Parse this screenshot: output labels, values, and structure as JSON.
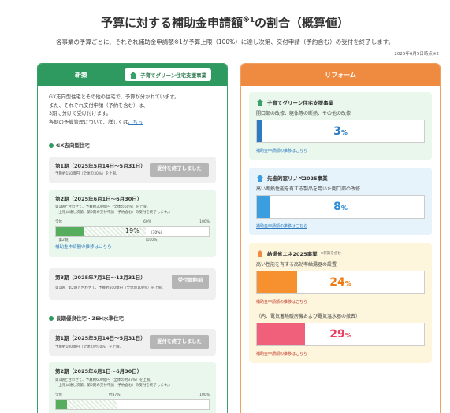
{
  "header": {
    "title": "予算に対する補助金申請額",
    "title_sup": "※1",
    "title_suffix": "の割合（概算値）",
    "subtitle": "各事業の予算ごとに、それぞれ補助金申請額※1が予算上限（100%）に達し次第、交付申請（予約含む）の受付を終了します。",
    "date": "2025年6月5日時点※2"
  },
  "colors": {
    "green": "#2e9a5f",
    "orange": "#ef8a41",
    "blue_bar": "#3a9ee0",
    "orange_bar": "#f7902e",
    "pink_bar": "#f0607a",
    "gray_bar": "#b5b5b5"
  },
  "left": {
    "header": "新築",
    "tag": "子育てグリーン住宅支援事業",
    "intro": [
      "GX志向型住宅とその他の住宅で、予算が分かれています。",
      "また、それぞれ交付申請（予約を含む）は、",
      "3期に分けて受け付けます。"
    ],
    "intro_last": "各期の予算管理について、詳しくは",
    "intro_link": "こちら",
    "gx": {
      "heading": "GX志向型住宅",
      "phase1": {
        "title": "第1期（2025年5月14日〜5月31日）",
        "desc": "予算約150億円（全体の30%）を上限。",
        "button": "受付を終了しました"
      },
      "phase2": {
        "title": "第2期（2025年6月1日〜6月30日）",
        "desc1": "第1期と合わせて、予算約300億円（全体の60%）を上限。",
        "desc2": "（上限に達し次第、第2期の交付申請（予約含む）の受付を終了します。）",
        "label_all": "全体",
        "label_60": "60%",
        "label_100": "100%",
        "percent": "19",
        "unit": "%",
        "marker": "（30%）",
        "under_left": "（第2期）",
        "under_right": "（100%）",
        "link": "補助金申請額の推移はこちら",
        "value": 0.19
      },
      "phase3": {
        "title": "第3期（2025年7月1日〜12月31日）",
        "desc": "第1期、第2期と合わせて、予算約500億円（全体の100%）を上限。",
        "button": "受付開始前"
      }
    },
    "long": {
      "heading": "長期優良住宅・ZEH水準住宅",
      "phase1": {
        "title": "第1期（2025年5月14日〜5月31日）",
        "desc": "予算約100億円（全体の約10%）を上限。",
        "button": "受付を終了しました"
      },
      "phase2": {
        "title": "第2期（2025年6月1日〜6月30日）",
        "desc1": "第1期と合わせて、予算約600億円（全体の約37%）を上限。",
        "desc2": "（上限に達し次第、第2期の交付申請（予約含む）の受付を終了します。）",
        "label_all": "全体",
        "label_37": "約37%",
        "label_100": "100%"
      }
    }
  },
  "right": {
    "header": "リフォーム",
    "cards": [
      {
        "title": "子育てグリーン住宅支援事業",
        "desc": "開口部の改修、躯体等の断熱、その他の改修",
        "percent": "3",
        "unit": "%",
        "value": 0.03,
        "link": "補助金申請額の推移はこちら"
      },
      {
        "title": "先進的窓リノベ2025事業",
        "desc": "高い断熱性能を有する製品を用いた開口部の改修",
        "percent": "8",
        "unit": "%",
        "value": 0.08,
        "link": "補助金申請額の推移はこちら"
      },
      {
        "title": "給湯省エネ2025事業",
        "note": "※新築を含む",
        "desc": "高い性能を有する高効率給湯器の設置",
        "percent": "24",
        "unit": "%",
        "value": 0.24,
        "link": "補助金申請額の推移はこちら",
        "sub": "（内、電気蓄熱暖房機および電気温水器の撤去）",
        "percent2": "29",
        "unit2": "%",
        "value2": 0.29,
        "link2": "補助金申請額の推移はこちら"
      }
    ]
  }
}
